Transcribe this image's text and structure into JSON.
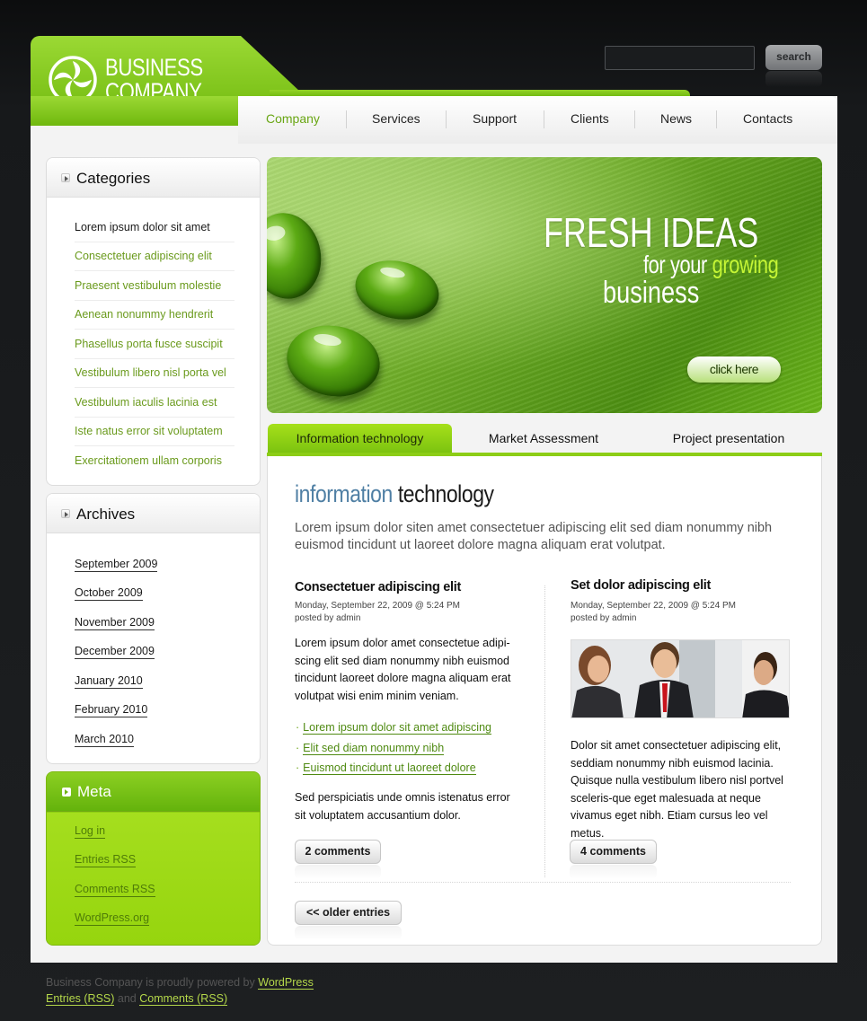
{
  "brand": {
    "line1": "BUSINESS",
    "line2": "COMPANY",
    "accent": "#7cc310"
  },
  "search": {
    "button_label": "search",
    "value": ""
  },
  "nav": [
    "Company",
    "Services",
    "Support",
    "Clients",
    "News",
    "Contacts"
  ],
  "categories": {
    "title": "Categories",
    "items": [
      "Lorem ipsum dolor sit amet",
      "Consectetuer adipiscing elit",
      "Praesent vestibulum molestie",
      "Aenean nonummy hendrerit",
      "Phasellus porta fusce suscipit",
      "Vestibulum libero nisl porta vel",
      "Vestibulum iaculis lacinia est",
      "Iste natus error sit voluptatem",
      "Exercitationem ullam corporis"
    ]
  },
  "archives": {
    "title": "Archives",
    "items": [
      "September 2009",
      "October 2009",
      "November 2009",
      "December 2009",
      "January 2010",
      "February 2010",
      "March 2010"
    ]
  },
  "meta": {
    "title": "Meta",
    "items": [
      "Log in",
      "Entries RSS",
      "Comments RSS",
      "WordPress.org"
    ]
  },
  "banner": {
    "headline": "FRESH IDEAS",
    "line2_a": "for your",
    "line2_b": "growing",
    "line3": "business",
    "button": "click here"
  },
  "tabs": [
    "Information technology",
    "Market Assessment",
    "Project presentation"
  ],
  "section": {
    "title_a": "information",
    "title_b": "technology",
    "lead": "Lorem ipsum dolor siten amet consectetuer adipiscing elit sed diam nonummy nibh euismod tincidunt ut laoreet dolore magna aliquam erat volutpat."
  },
  "posts": [
    {
      "title": "Consectetuer adipiscing elit",
      "date": "Monday, September 22, 2009 @ 5:24 PM",
      "author": "posted by admin",
      "body": "Lorem ipsum dolor amet consectetue adipi-scing elit sed diam nonummy nibh euismod tincidunt laoreet dolore magna aliquam erat volutpat wisi enim minim veniam.",
      "links": [
        "Lorem ipsum dolor sit amet adipiscing",
        "Elit sed diam nonummy nibh",
        "Euismod tincidunt ut laoreet dolore"
      ],
      "body2": "Sed perspiciatis unde omnis istenatus error sit voluptatem accusantium dolor.",
      "comments": "2 comments"
    },
    {
      "title": "Set dolor adipiscing elit",
      "date": "Monday, September 22, 2009 @ 5:24 PM",
      "author": "posted by admin",
      "body": "Dolor sit amet consectetuer adipiscing elit, seddiam nonummy nibh euismod lacinia. Quisque nulla vestibulum libero nisl portvel sceleris-que eget malesuada at neque vivamus eget nibh. Etiam cursus leo vel metus.",
      "comments": "4 comments"
    }
  ],
  "older_entries": "<< older entries",
  "footer": {
    "line1_text": "Business Company is proudly powered by",
    "line1_link": "WordPress",
    "entries": "Entries (RSS)",
    "and": "and",
    "comments": "Comments (RSS)"
  }
}
